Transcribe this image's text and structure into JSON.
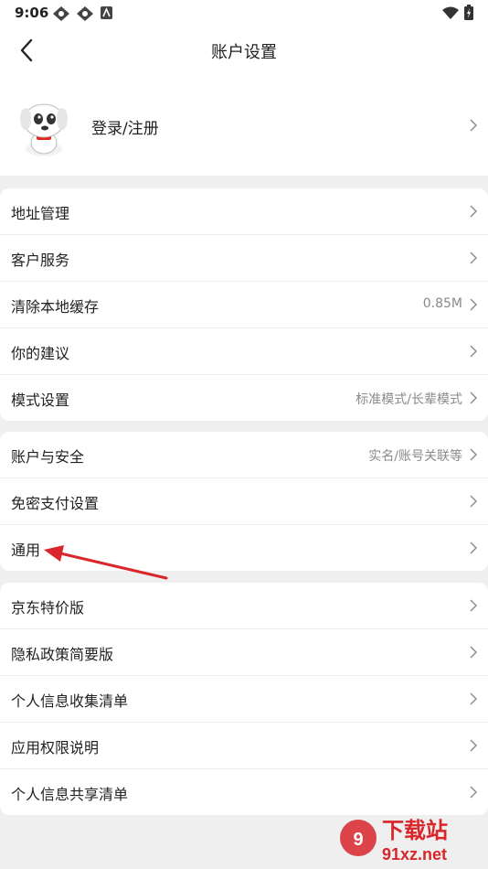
{
  "status_bar": {
    "time": "9:06",
    "icons": [
      "app-notification-icon",
      "app-notification-icon",
      "keyboard-notification-icon",
      "wifi-icon",
      "battery-charging-icon"
    ]
  },
  "header": {
    "title": "账户设置",
    "back_icon": "chevron-left-icon"
  },
  "profile": {
    "login_label": "登录/注册",
    "avatar": "mascot-avatar"
  },
  "groups": [
    [
      {
        "label": "地址管理",
        "value": ""
      },
      {
        "label": "客户服务",
        "value": ""
      },
      {
        "label": "清除本地缓存",
        "value": "0.85M"
      },
      {
        "label": "你的建议",
        "value": ""
      },
      {
        "label": "模式设置",
        "value": "标准模式/长辈模式"
      }
    ],
    [
      {
        "label": "账户与安全",
        "value": "实名/账号关联等"
      },
      {
        "label": "免密支付设置",
        "value": ""
      },
      {
        "label": "通用",
        "value": ""
      }
    ],
    [
      {
        "label": "京东特价版",
        "value": ""
      },
      {
        "label": "隐私政策简要版",
        "value": ""
      },
      {
        "label": "个人信息收集清单",
        "value": ""
      },
      {
        "label": "应用权限说明",
        "value": ""
      },
      {
        "label": "个人信息共享清单",
        "value": ""
      }
    ]
  ],
  "annotation": {
    "color": "#d9262b",
    "icon": "red-arrow-annotation"
  },
  "watermark": {
    "text": "下载站",
    "url_text": "91xz.net"
  }
}
